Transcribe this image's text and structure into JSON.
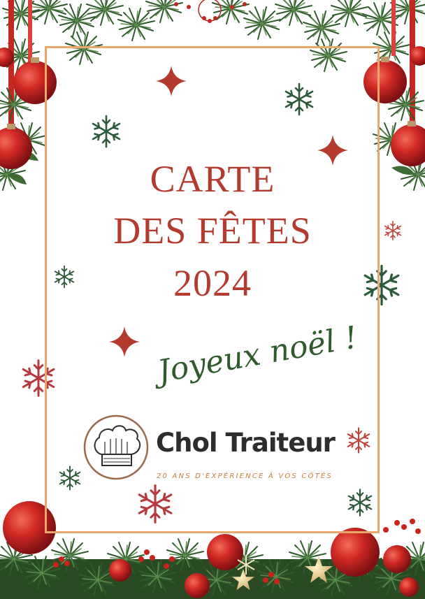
{
  "title": {
    "line1": "CARTE",
    "line2": "DES FÊTES",
    "line3": "2024"
  },
  "greeting": "Joyeux noël !",
  "brand": {
    "name": "Chol Traiteur",
    "tagline": "20 ANS D'EXPÉRIENCE À VOS CÔTÉS",
    "logo_icon": "chef-hat-icon"
  },
  "colors": {
    "title_red": "#b53a2e",
    "frame_orange": "#e8a86c",
    "pine_green": "#2f5b2c",
    "snow_green": "#2d5a3a",
    "brand_dark": "#2d2d2d",
    "tagline_gold": "#c5803b"
  },
  "decorations": [
    "pine-garland-top",
    "red-bauble",
    "snowflake",
    "star",
    "pine-garland-bottom",
    "gold-star",
    "holly-berries"
  ]
}
